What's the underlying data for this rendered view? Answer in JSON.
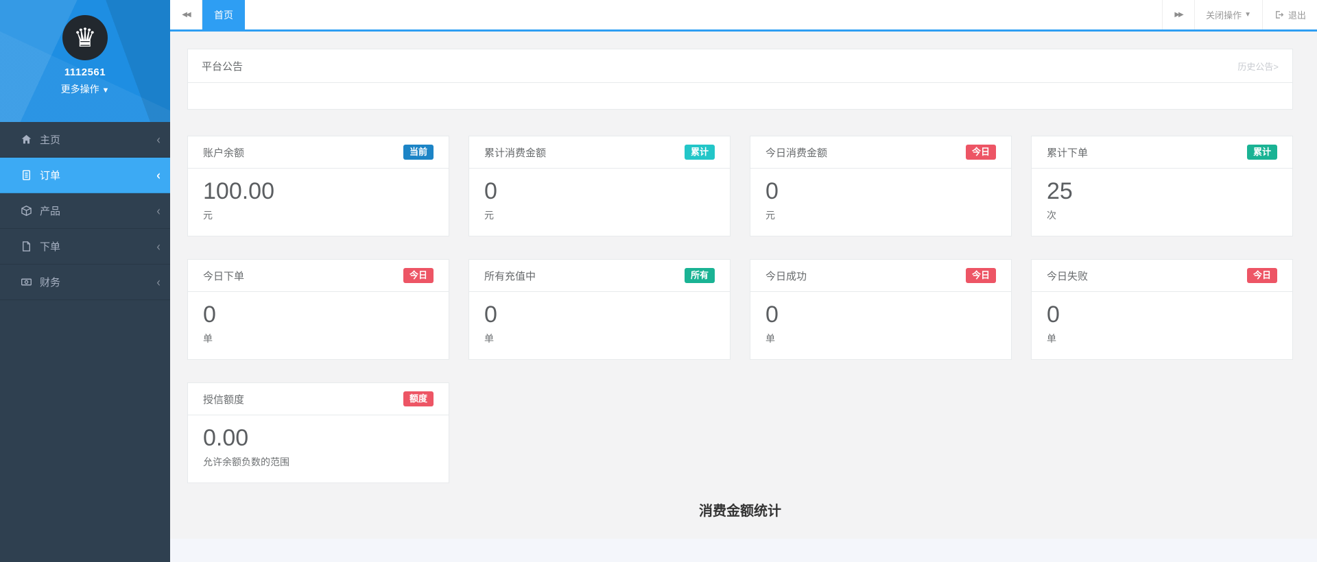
{
  "sidebar": {
    "username": "1112561",
    "more_actions": "更多操作",
    "menu": [
      {
        "label": "主页",
        "icon": "home-icon"
      },
      {
        "label": "订单",
        "icon": "orders-icon"
      },
      {
        "label": "产品",
        "icon": "products-icon"
      },
      {
        "label": "下单",
        "icon": "place-order-icon"
      },
      {
        "label": "财务",
        "icon": "finance-icon"
      }
    ]
  },
  "topbar": {
    "active_tab": "首页",
    "close_actions": "关闭操作",
    "logout": "退出"
  },
  "announcement": {
    "title": "平台公告",
    "history_link": "历史公告>"
  },
  "cards": [
    {
      "title": "账户余额",
      "badge": "当前",
      "badge_color": "#1c84c6",
      "value": "100.00",
      "unit": "元"
    },
    {
      "title": "累计消费金额",
      "badge": "累计",
      "badge_color": "#23c6c8",
      "value": "0",
      "unit": "元"
    },
    {
      "title": "今日消费金额",
      "badge": "今日",
      "badge_color": "#ed5565",
      "value": "0",
      "unit": "元"
    },
    {
      "title": "累计下单",
      "badge": "累计",
      "badge_color": "#1ab394",
      "value": "25",
      "unit": "次"
    },
    {
      "title": "今日下单",
      "badge": "今日",
      "badge_color": "#ed5565",
      "value": "0",
      "unit": "单"
    },
    {
      "title": "所有充值中",
      "badge": "所有",
      "badge_color": "#1ab394",
      "value": "0",
      "unit": "单"
    },
    {
      "title": "今日成功",
      "badge": "今日",
      "badge_color": "#ed5565",
      "value": "0",
      "unit": "单"
    },
    {
      "title": "今日失败",
      "badge": "今日",
      "badge_color": "#ed5565",
      "value": "0",
      "unit": "单"
    },
    {
      "title": "授信额度",
      "badge": "额度",
      "badge_color": "#ed5565",
      "value": "0.00",
      "unit": "允许余额负数的范围"
    }
  ],
  "chart": {
    "title": "消费金额统计"
  },
  "colors": {
    "sidebar_bg": "#2f4050",
    "sidebar_header_blue": "#1e8ee2",
    "active_blue": "#3caaf4",
    "topbar_accent": "#2e9ef3",
    "content_bg": "#f3f3f4",
    "badge_blue": "#1c84c6",
    "badge_cyan": "#23c6c8",
    "badge_green": "#1ab394",
    "badge_red": "#ed5565"
  }
}
